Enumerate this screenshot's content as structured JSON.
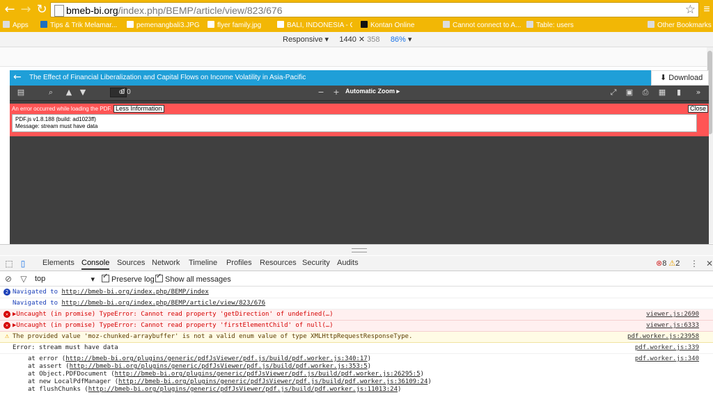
{
  "browser": {
    "url_host": "bmeb-bi.org",
    "url_path": "/index.php/BEMP/article/view/823/676",
    "bookmarks": [
      "Apps",
      "Tips & Trik Melamar...",
      "pemenangbali3.JPG",
      "flyer family.jpg",
      "BALI, INDONESIA - C...",
      "Kontan Online",
      "Cannot connect to A...",
      "Table: users",
      "Other Bookmarks"
    ]
  },
  "device_bar": {
    "mode": "Responsive",
    "width": "1440",
    "height": "358",
    "zoom": "86%"
  },
  "viewer": {
    "title": "The Effect of Financial Liberalization and Capital Flows on Income Volatility in Asia-Pacific",
    "download_label": "Download",
    "page_number": "0",
    "page_count": "of 0",
    "zoom_label": "Automatic Zoom",
    "error_message": "An error occurred while loading the PDF.",
    "less_info_label": "Less Information",
    "close_label": "Close",
    "error_detail": "PDF.js v1.8.188 (build: ad1023ff)\nMessage: stream must have data"
  },
  "devtools": {
    "tabs": [
      "Elements",
      "Console",
      "Sources",
      "Network",
      "Timeline",
      "Profiles",
      "Resources",
      "Security",
      "Audits"
    ],
    "active_tab": "Console",
    "error_count": "8",
    "warning_count": "2",
    "context": "top",
    "preserve_log": "Preserve log",
    "show_all": "Show all messages",
    "messages": [
      {
        "type": "nav",
        "badge": "2",
        "text": "Navigated to ",
        "link": "http://bmeb-bi.org/index.php/BEMP/index",
        "src": ""
      },
      {
        "type": "nav",
        "badge": "",
        "text": "Navigated to ",
        "link": "http://bmeb-bi.org/index.php/BEMP/article/view/823/676",
        "src": ""
      },
      {
        "type": "err",
        "text": "▶Uncaught (in promise) TypeError: Cannot read property 'getDirection' of undefined(…)",
        "src": "viewer.js:2690"
      },
      {
        "type": "err",
        "text": "▶Uncaught (in promise) TypeError: Cannot read property 'firstElementChild' of null(…)",
        "src": "viewer.js:6333"
      },
      {
        "type": "warn",
        "text": "The provided value 'moz-chunked-arraybuffer' is not a valid enum value of type XMLHttpRequestResponseType.",
        "src": "pdf.worker.js:23958"
      },
      {
        "type": "log",
        "text": "Error: stream must have data",
        "src": "pdf.worker.js:339"
      }
    ],
    "stack": [
      {
        "prefix": "at error (",
        "link": "http://bmeb-bi.org/plugins/generic/pdfJsViewer/pdf.js/build/pdf.worker.js:340:17",
        "suffix": ")",
        "src": "pdf.worker.js:340"
      },
      {
        "prefix": "at assert (",
        "link": "http://bmeb-bi.org/plugins/generic/pdfJsViewer/pdf.js/build/pdf.worker.js:353:5",
        "suffix": ")",
        "src": ""
      },
      {
        "prefix": "at Object.PDFDocument (",
        "link": "http://bmeb-bi.org/plugins/generic/pdfJsViewer/pdf.js/build/pdf.worker.js:26295:5",
        "suffix": ")",
        "src": ""
      },
      {
        "prefix": "at new LocalPdfManager (",
        "link": "http://bmeb-bi.org/plugins/generic/pdfJsViewer/pdf.js/build/pdf.worker.js:36109:24",
        "suffix": ")",
        "src": ""
      },
      {
        "prefix": "at flushChunks (",
        "link": "http://bmeb-bi.org/plugins/generic/pdfJsViewer/pdf.js/build/pdf.worker.js:11013:24",
        "suffix": ")",
        "src": ""
      }
    ]
  }
}
